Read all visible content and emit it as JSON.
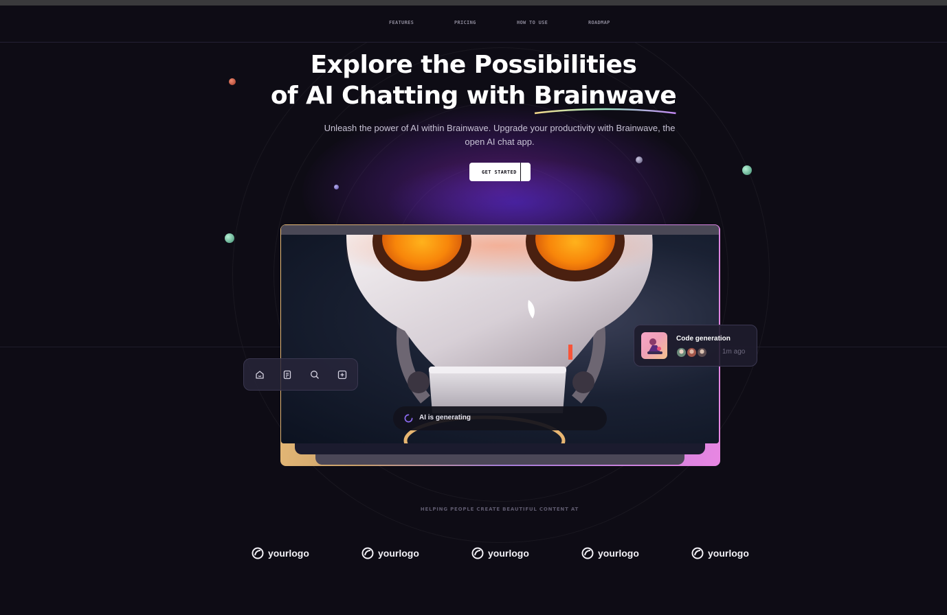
{
  "nav": {
    "items": [
      "FEATURES",
      "PRICING",
      "HOW TO USE",
      "ROADMAP"
    ]
  },
  "hero": {
    "title_line1": "Explore the Possibilities",
    "title_line2_prefix": "of AI Chatting with ",
    "title_brand": "Brainwave",
    "subtitle": "Unleash the power of AI within Brainwave. Upgrade your productivity with Brainwave, the open AI chat app.",
    "cta_label": "GET STARTED"
  },
  "toolbar": {
    "icons": [
      "home-smile-icon",
      "file-text-icon",
      "search-icon",
      "plus-square-icon"
    ]
  },
  "generating": {
    "text": "AI is generating",
    "icon": "loading-spinner-icon"
  },
  "notification": {
    "title": "Code generation",
    "time": "1m ago",
    "avatar_count": 3
  },
  "companies": {
    "heading": "HELPING PEOPLE CREATE BEAUTIFUL CONTENT AT",
    "logos": [
      "yourlogo",
      "yourlogo",
      "yourlogo",
      "yourlogo",
      "yourlogo"
    ]
  },
  "colors": {
    "background": "#0e0c15",
    "accent_orange": "#f29a20",
    "gradient_start": "#eec07a",
    "gradient_end": "#e886e2",
    "spinner": "#8c6bf0"
  }
}
